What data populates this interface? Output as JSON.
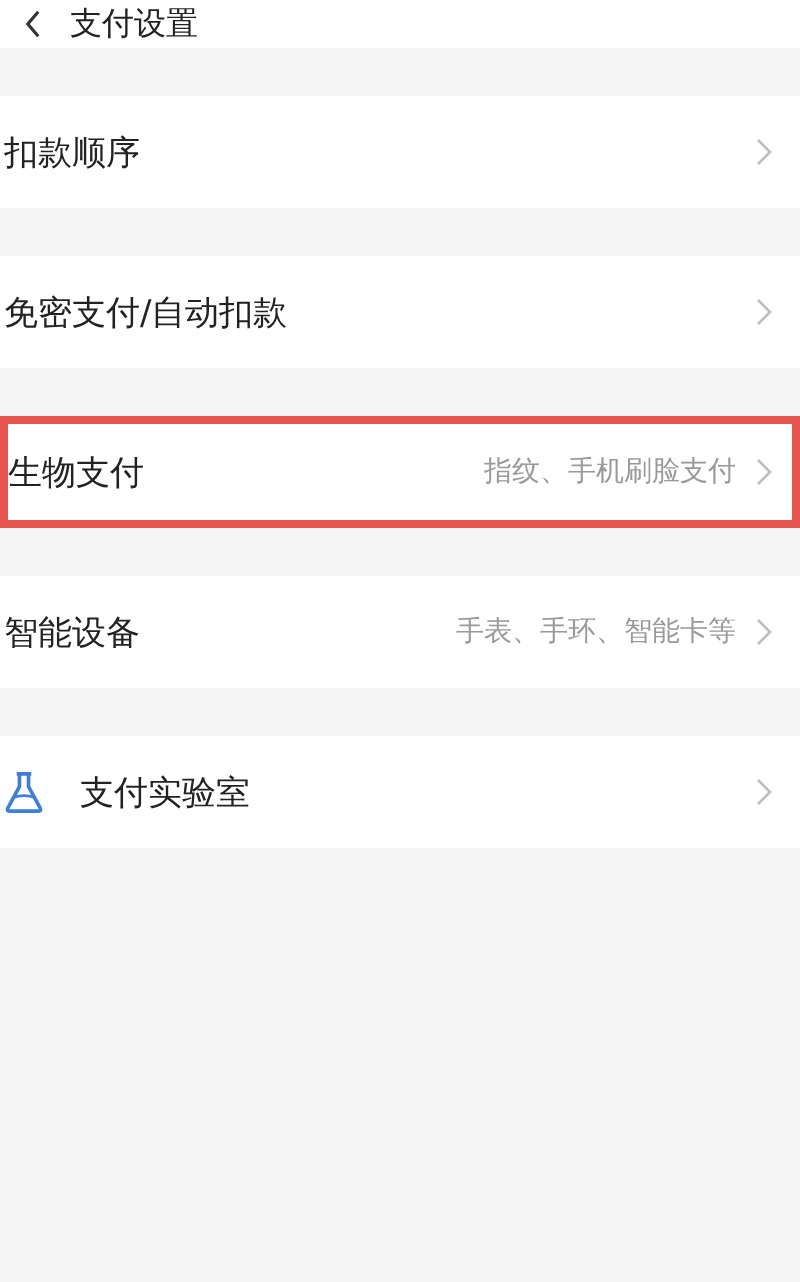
{
  "header": {
    "title": "支付设置"
  },
  "items": [
    {
      "kind": "plain",
      "label": "扣款顺序",
      "highlighted": false
    },
    {
      "kind": "plain",
      "label": "免密支付/自动扣款",
      "highlighted": false
    },
    {
      "kind": "plain",
      "label": "生物支付",
      "detail": "指纹、手机刷脸支付",
      "highlighted": true
    },
    {
      "kind": "plain",
      "label": "智能设备",
      "detail": "手表、手环、智能卡等",
      "highlighted": false
    },
    {
      "kind": "lab",
      "label": "支付实验室",
      "highlighted": false
    }
  ]
}
